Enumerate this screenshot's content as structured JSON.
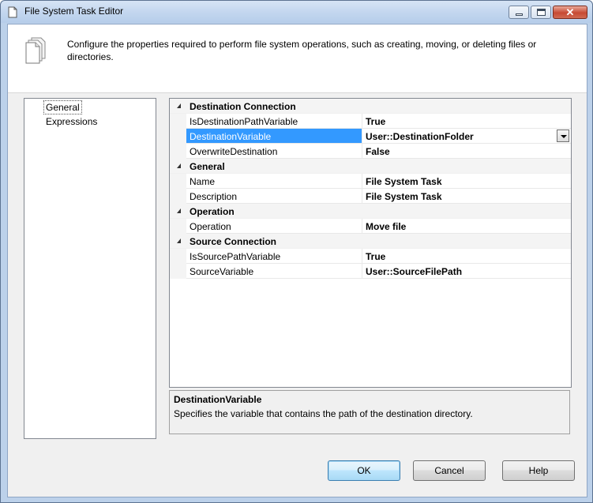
{
  "window": {
    "title": "File System Task Editor",
    "minimize_icon": "minimize-icon",
    "maximize_icon": "maximize-icon",
    "close_glyph": "✕"
  },
  "header": {
    "icon": "document-pages-icon",
    "description": "Configure the properties required to perform file system operations, such as creating, moving, or deleting files or directories."
  },
  "nav": {
    "items": [
      {
        "label": "General",
        "selected": true
      },
      {
        "label": "Expressions",
        "selected": false
      }
    ]
  },
  "property_grid": {
    "categories": [
      {
        "label": "Destination Connection",
        "properties": [
          {
            "name": "IsDestinationPathVariable",
            "value": "True"
          },
          {
            "name": "DestinationVariable",
            "value": "User::DestinationFolder",
            "selected": true,
            "has_dropdown": true
          },
          {
            "name": "OverwriteDestination",
            "value": "False"
          }
        ]
      },
      {
        "label": "General",
        "properties": [
          {
            "name": "Name",
            "value": "File System Task"
          },
          {
            "name": "Description",
            "value": "File System Task"
          }
        ]
      },
      {
        "label": "Operation",
        "properties": [
          {
            "name": "Operation",
            "value": "Move file"
          }
        ]
      },
      {
        "label": "Source Connection",
        "properties": [
          {
            "name": "IsSourcePathVariable",
            "value": "True"
          },
          {
            "name": "SourceVariable",
            "value": "User::SourceFilePath"
          }
        ]
      }
    ]
  },
  "description_pane": {
    "title": "DestinationVariable",
    "text": "Specifies the variable that contains the path of the destination directory."
  },
  "buttons": {
    "ok": "OK",
    "cancel": "Cancel",
    "help": "Help"
  },
  "colors": {
    "selection": "#3399ff",
    "title_bar": "#c4d7ef",
    "close_button": "#c74a33"
  }
}
